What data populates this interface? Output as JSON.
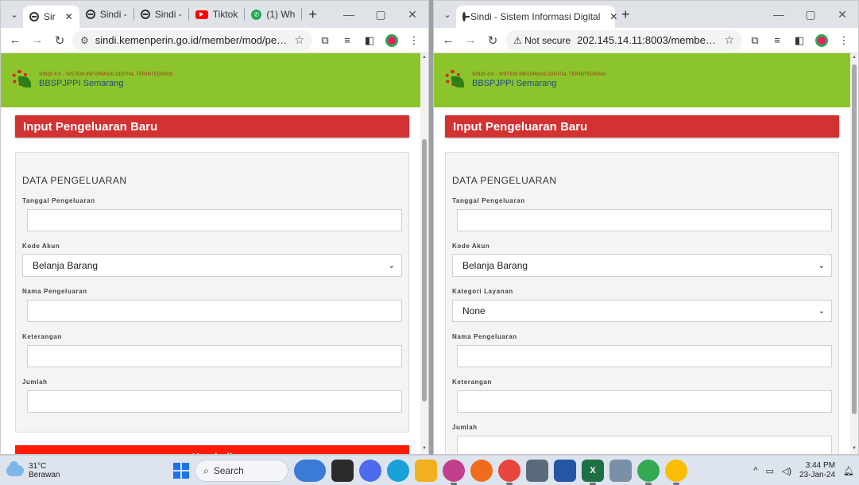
{
  "left_window": {
    "tabs": [
      {
        "label": "Sir",
        "icon": "globe-icon",
        "active": true
      },
      {
        "label": "Sindi -",
        "icon": "globe-icon"
      },
      {
        "label": "Sindi -",
        "icon": "globe-icon"
      },
      {
        "label": "Tiktok",
        "icon": "youtube-icon"
      },
      {
        "label": "(1) Wh",
        "icon": "whatsapp-icon"
      }
    ],
    "url": "sindi.kemenperin.go.id/member/mod/pen...",
    "header": {
      "tagline": "SINDI 4.0 - SISTEM INFORMASI DIGITAL TERINTEGRASI",
      "org": "BBSPJPPI Semarang"
    },
    "page_title": "Input Pengeluaran Baru",
    "section_title": "DATA PENGELUARAN",
    "fields": {
      "tanggal_label": "Tanggal Pengeluaran",
      "kode_akun_label": "Kode Akun",
      "kode_akun_value": "Belanja Barang",
      "nama_label": "Nama Pengeluaran",
      "keterangan_label": "Keterangan",
      "jumlah_label": "Jumlah"
    },
    "back_button": "Kembali"
  },
  "right_window": {
    "tab_label": "Sindi - Sistem Informasi Digital",
    "security_label": "Not secure",
    "url": "202.145.14.11:8003/member/m...",
    "header": {
      "tagline": "SINDI 4.0 - SISTEM INFORMASI DIGITAL TERINTEGRASI",
      "org": "BBSPJPPI Semarang"
    },
    "page_title": "Input Pengeluaran Baru",
    "section_title": "DATA PENGELUARAN",
    "fields": {
      "tanggal_label": "Tanggal Pengeluaran",
      "kode_akun_label": "Kode Akun",
      "kode_akun_value": "Belanja Barang",
      "kategori_label": "Kategori Layanan",
      "kategori_value": "None",
      "nama_label": "Nama Pengeluaran",
      "keterangan_label": "Keterangan",
      "jumlah_label": "Jumlah"
    }
  },
  "taskbar": {
    "weather_temp": "31°C",
    "weather_desc": "Berawan",
    "search_label": "Search",
    "time": "3:44 PM",
    "date": "23-Jan-24"
  },
  "colors": {
    "header_green": "#8bc52b",
    "title_red": "#d23232",
    "button_red": "#ff1a05",
    "brand_blue": "#1b4a86"
  }
}
